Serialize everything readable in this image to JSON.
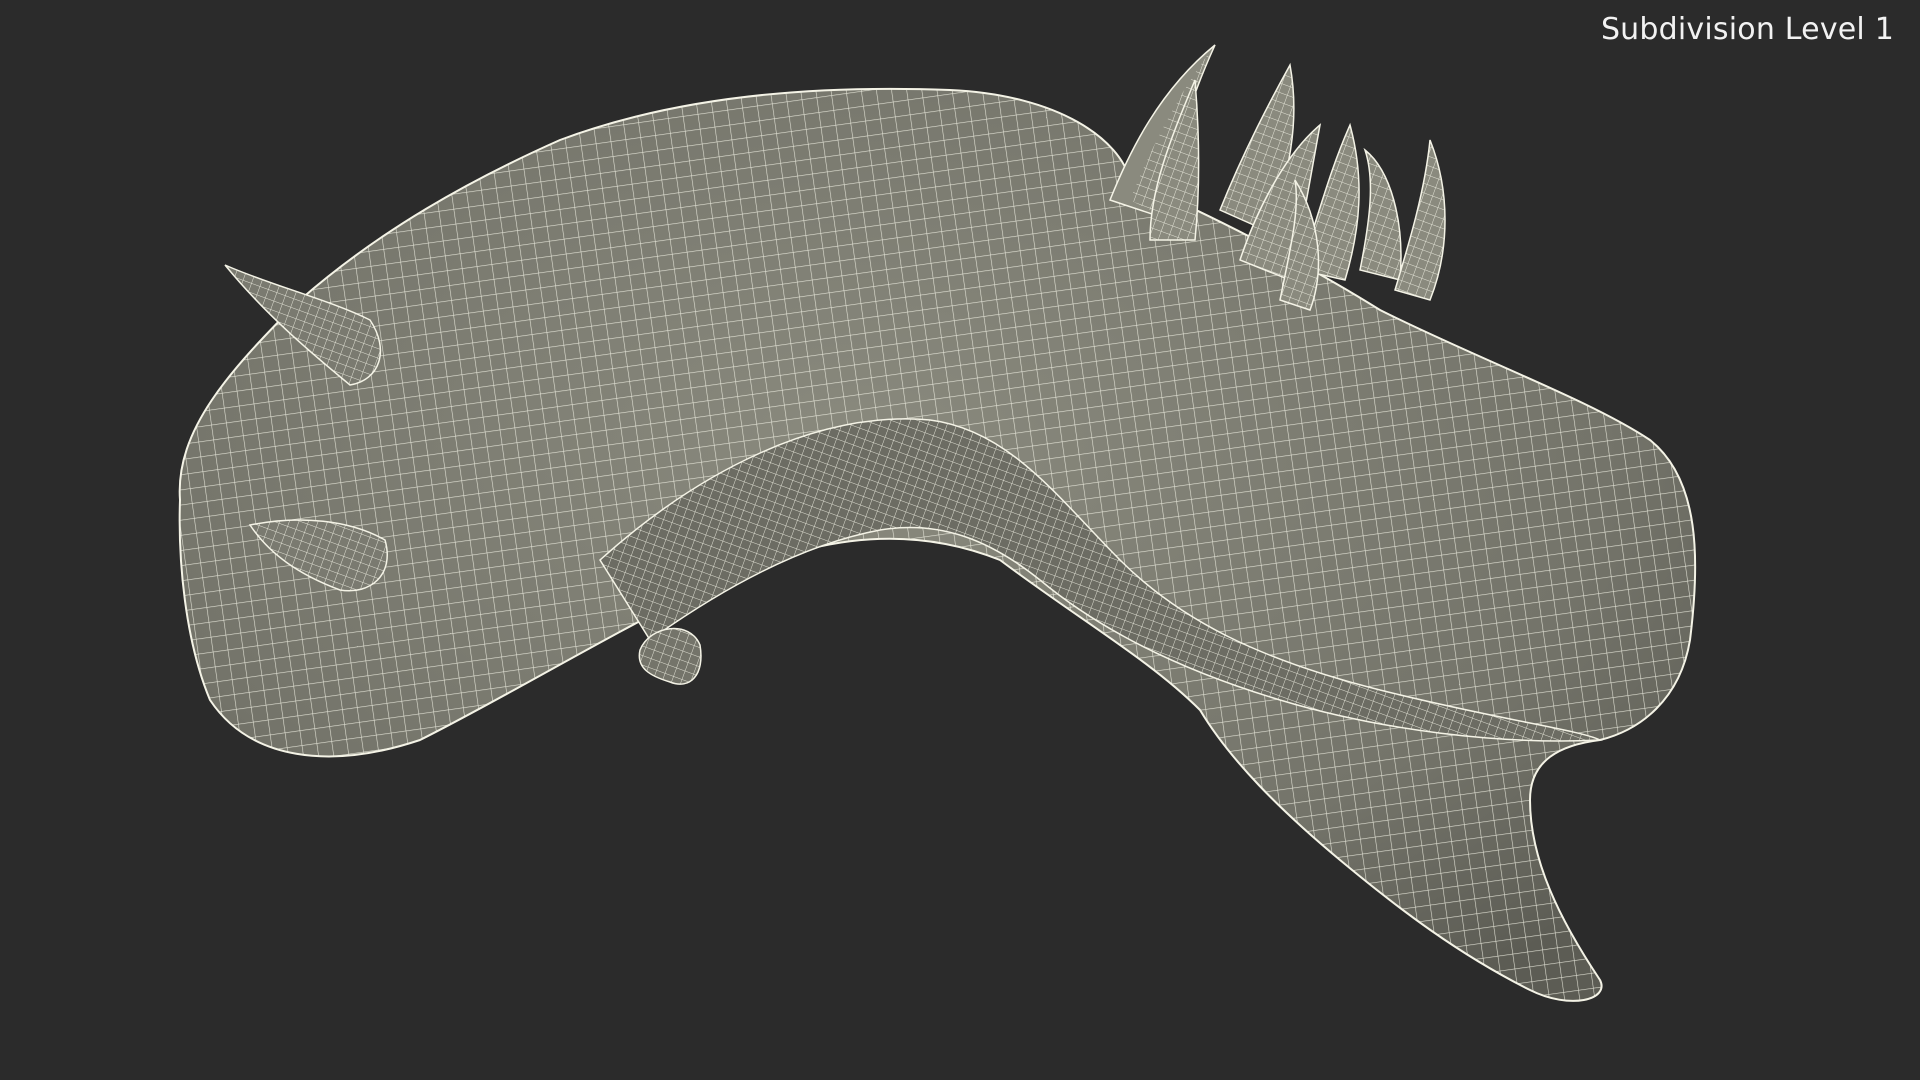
{
  "viewport": {
    "label": "Subdivision Level 1"
  },
  "model": {
    "display_mode": "wireframe-on-shaded",
    "background_color": "#2b2b2b",
    "surface_color": "#7d7d72",
    "wire_color": "#f4f3e6"
  }
}
